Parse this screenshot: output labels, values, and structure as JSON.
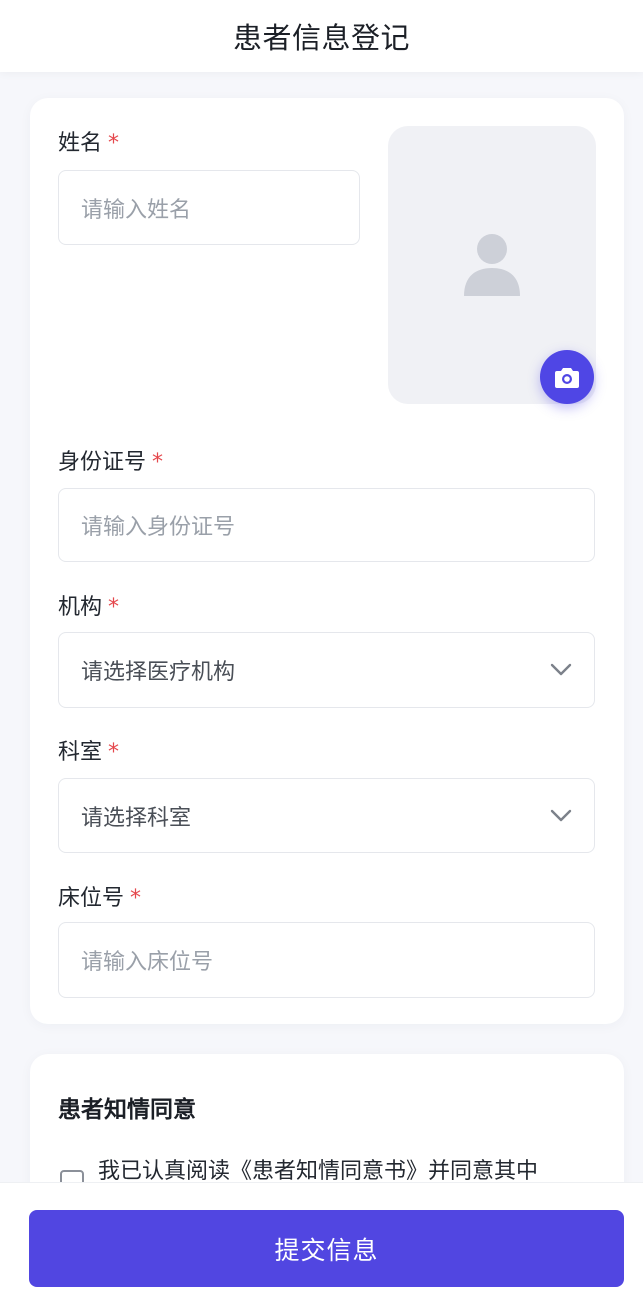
{
  "header": {
    "title": "患者信息登记"
  },
  "form": {
    "name": {
      "label": "姓名",
      "required_mark": "*",
      "placeholder": "请输入姓名"
    },
    "id_number": {
      "label": "身份证号",
      "required_mark": "*",
      "placeholder": "请输入身份证号"
    },
    "institution": {
      "label": "机构",
      "required_mark": "*",
      "selected": "请选择医疗机构"
    },
    "department": {
      "label": "科室",
      "required_mark": "*",
      "selected": "请选择科室"
    },
    "bed": {
      "label": "床位号",
      "required_mark": "*",
      "placeholder": "请输入床位号"
    },
    "photo": {
      "avatar_icon": "user-avatar-placeholder-icon",
      "camera_icon": "camera-icon"
    }
  },
  "consent": {
    "title": "患者知情同意",
    "text": "我已认真阅读《患者知情同意书》并同意其中"
  },
  "footer": {
    "submit_label": "提交信息"
  },
  "colors": {
    "primary": "#5146e1",
    "required": "#e5484d",
    "background": "#f6f7fb"
  }
}
